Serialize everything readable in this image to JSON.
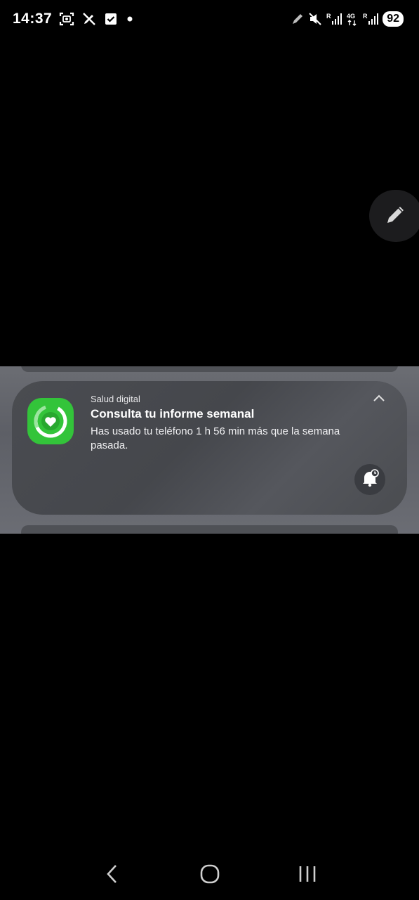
{
  "status_bar": {
    "time": "14:37",
    "battery": "92",
    "left_icons": [
      "screenshot-icon",
      "no-edit-icon",
      "checkbox-icon",
      "dot-icon"
    ],
    "right_icons": [
      "pen-icon",
      "mute-icon",
      "signal-r-icon",
      "4g-icon",
      "signal-r2-icon"
    ]
  },
  "notification": {
    "app_name": "Salud digital",
    "title": "Consulta tu informe semanal",
    "body": "Has usado tu teléfono 1 h 56 min más que la semana pasada.",
    "icon": "digital-wellbeing-icon",
    "accent_color": "#33c43a"
  },
  "navigation": {
    "buttons": [
      "back-icon",
      "home-icon",
      "recents-icon"
    ]
  },
  "colors": {
    "background": "#000000",
    "card": "#4a4c51",
    "band": "#5d5f66"
  }
}
